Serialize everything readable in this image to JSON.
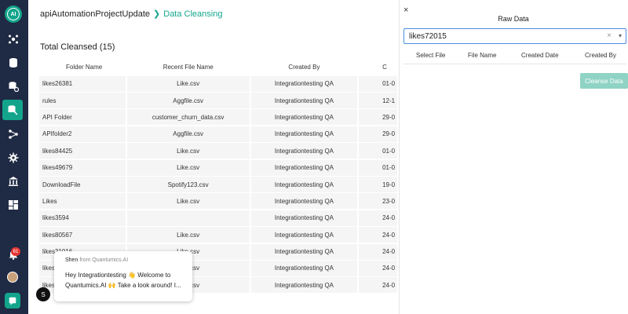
{
  "breadcrumb": {
    "root": "apiAutomationProjectUpdate",
    "separator": "❯",
    "current": "Data Cleansing"
  },
  "summary": {
    "total_label": "Total Cleansed (15)"
  },
  "table": {
    "headers": [
      "Folder Name",
      "Recent File Name",
      "Created By",
      "C"
    ],
    "rows": [
      {
        "folder": "likes26381",
        "file": "Like.csv",
        "created_by": "Integrationtesting QA",
        "created": "01-0"
      },
      {
        "folder": "rules",
        "file": "Aggfile.csv",
        "created_by": "Integrationtesting QA",
        "created": "12-1"
      },
      {
        "folder": "API Folder",
        "file": "customer_churn_data.csv",
        "created_by": "Integrationtesting QA",
        "created": "29-0"
      },
      {
        "folder": "APIfolder2",
        "file": "Aggfile.csv",
        "created_by": "Integrationtesting QA",
        "created": "29-0"
      },
      {
        "folder": "likes84425",
        "file": "Like.csv",
        "created_by": "Integrationtesting QA",
        "created": "01-0"
      },
      {
        "folder": "likes49679",
        "file": "Like.csv",
        "created_by": "Integrationtesting QA",
        "created": "01-0"
      },
      {
        "folder": "DownloadFile",
        "file": "Spotify123.csv",
        "created_by": "Integrationtesting QA",
        "created": "19-0"
      },
      {
        "folder": "Likes",
        "file": "Like.csv",
        "created_by": "Integrationtesting QA",
        "created": "23-0"
      },
      {
        "folder": "likes3594",
        "file": "",
        "created_by": "Integrationtesting QA",
        "created": "24-0"
      },
      {
        "folder": "likes80567",
        "file": "Like.csv",
        "created_by": "Integrationtesting QA",
        "created": "24-0"
      },
      {
        "folder": "likes31016",
        "file": "Like.csv",
        "created_by": "Integrationtesting QA",
        "created": "24-0"
      },
      {
        "folder": "likes",
        "file": "Like.csv",
        "created_by": "Integrationtesting QA",
        "created": "24-0"
      },
      {
        "folder": "likes",
        "file": "Like.csv",
        "created_by": "Integrationtesting QA",
        "created": "24-0"
      }
    ]
  },
  "drawer": {
    "close_icon": "×",
    "title": "Raw Data",
    "select_value": "likes72015",
    "clear_icon": "×",
    "caret_icon": "▾",
    "headers": [
      "Select File",
      "File Name",
      "Created Date",
      "Created By"
    ],
    "cleanse_label": "Cleanse Data"
  },
  "sidebar": {
    "logo_text": "AI",
    "notification_count": "61"
  },
  "chat": {
    "avatar_letter": "S",
    "from_name": "Shen",
    "from_org": "from Quantumics.AI",
    "message": "Hey Integrationtesting 👋 Welcome to Quantumics.AI 🙌 Take a look around! I..."
  },
  "colors": {
    "accent": "#12a58c",
    "sidebar": "#1f2a44",
    "badge": "#e53935",
    "button_disabled": "#8fd3c5"
  }
}
